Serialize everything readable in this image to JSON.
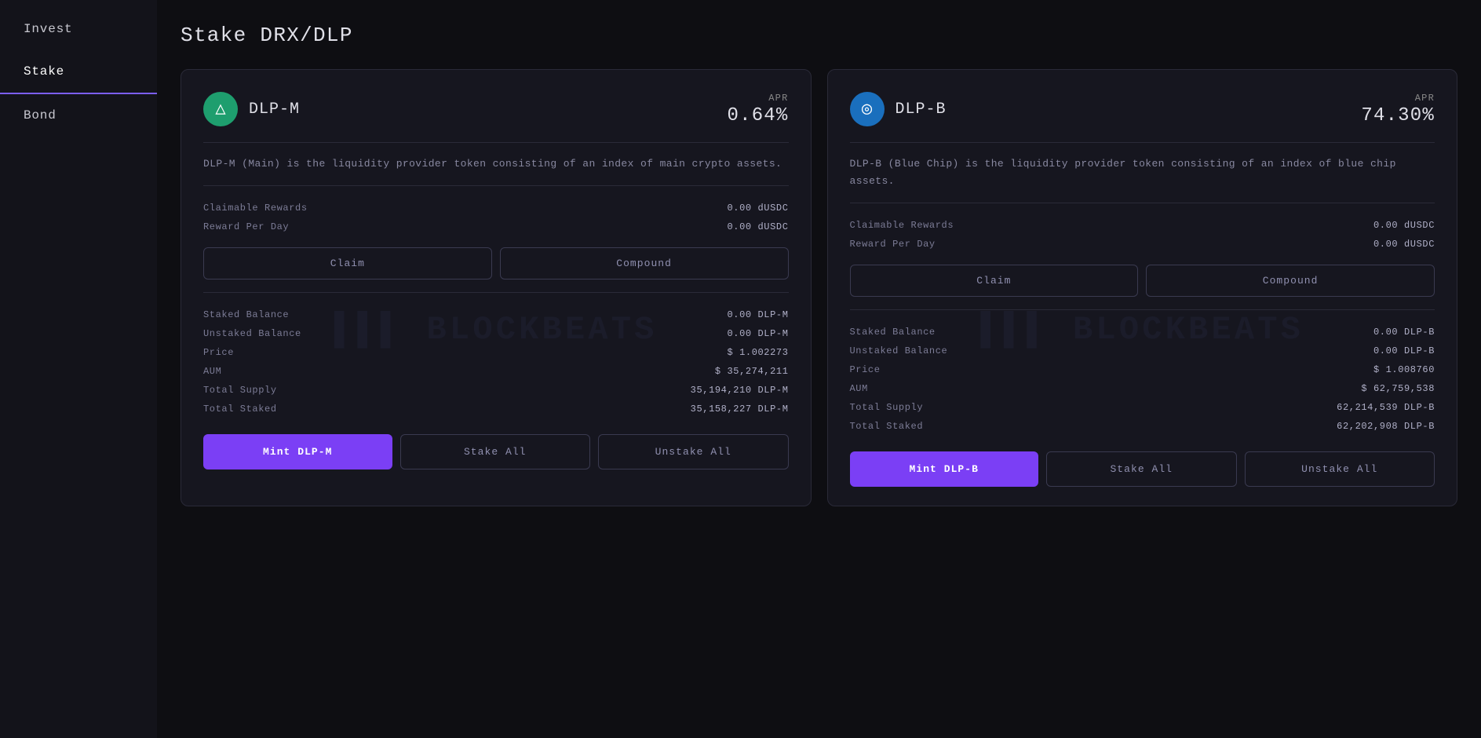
{
  "sidebar": {
    "items": [
      {
        "id": "invest",
        "label": "Invest",
        "active": false
      },
      {
        "id": "stake",
        "label": "Stake",
        "active": true
      },
      {
        "id": "bond",
        "label": "Bond",
        "active": false
      }
    ]
  },
  "page": {
    "title": "Stake DRX/DLP"
  },
  "cards": [
    {
      "id": "dlp-m",
      "token_name": "DLP-M",
      "icon_type": "green",
      "apr_label": "APR",
      "apr_value": "0.64%",
      "description": "DLP-M (Main) is the liquidity provider token consisting of an index of main crypto assets.",
      "claimable_rewards_label": "Claimable Rewards",
      "claimable_rewards_value": "0.00 dUSDC",
      "reward_per_day_label": "Reward Per Day",
      "reward_per_day_value": "0.00 dUSDC",
      "claim_label": "Claim",
      "compound_label": "Compound",
      "staked_balance_label": "Staked Balance",
      "staked_balance_value": "0.00 DLP-M",
      "unstaked_balance_label": "Unstaked Balance",
      "unstaked_balance_value": "0.00 DLP-M",
      "price_label": "Price",
      "price_value": "$ 1.002273",
      "aum_label": "AUM",
      "aum_value": "$ 35,274,211",
      "total_supply_label": "Total Supply",
      "total_supply_value": "35,194,210 DLP-M",
      "total_staked_label": "Total Staked",
      "total_staked_value": "35,158,227 DLP-M",
      "mint_label": "Mint DLP-M",
      "stake_all_label": "Stake All",
      "unstake_all_label": "Unstake All"
    },
    {
      "id": "dlp-b",
      "token_name": "DLP-B",
      "icon_type": "blue",
      "apr_label": "APR",
      "apr_value": "74.30%",
      "description": "DLP-B (Blue Chip) is the liquidity provider token consisting of an index of blue chip assets.",
      "claimable_rewards_label": "Claimable Rewards",
      "claimable_rewards_value": "0.00 dUSDC",
      "reward_per_day_label": "Reward Per Day",
      "reward_per_day_value": "0.00 dUSDC",
      "claim_label": "Claim",
      "compound_label": "Compound",
      "staked_balance_label": "Staked Balance",
      "staked_balance_value": "0.00 DLP-B",
      "unstaked_balance_label": "Unstaked Balance",
      "unstaked_balance_value": "0.00 DLP-B",
      "price_label": "Price",
      "price_value": "$ 1.008760",
      "aum_label": "AUM",
      "aum_value": "$ 62,759,538",
      "total_supply_label": "Total Supply",
      "total_supply_value": "62,214,539 DLP-B",
      "total_staked_label": "Total Staked",
      "total_staked_value": "62,202,908 DLP-B",
      "mint_label": "Mint DLP-B",
      "stake_all_label": "Stake All",
      "unstake_all_label": "Unstake All"
    }
  ]
}
